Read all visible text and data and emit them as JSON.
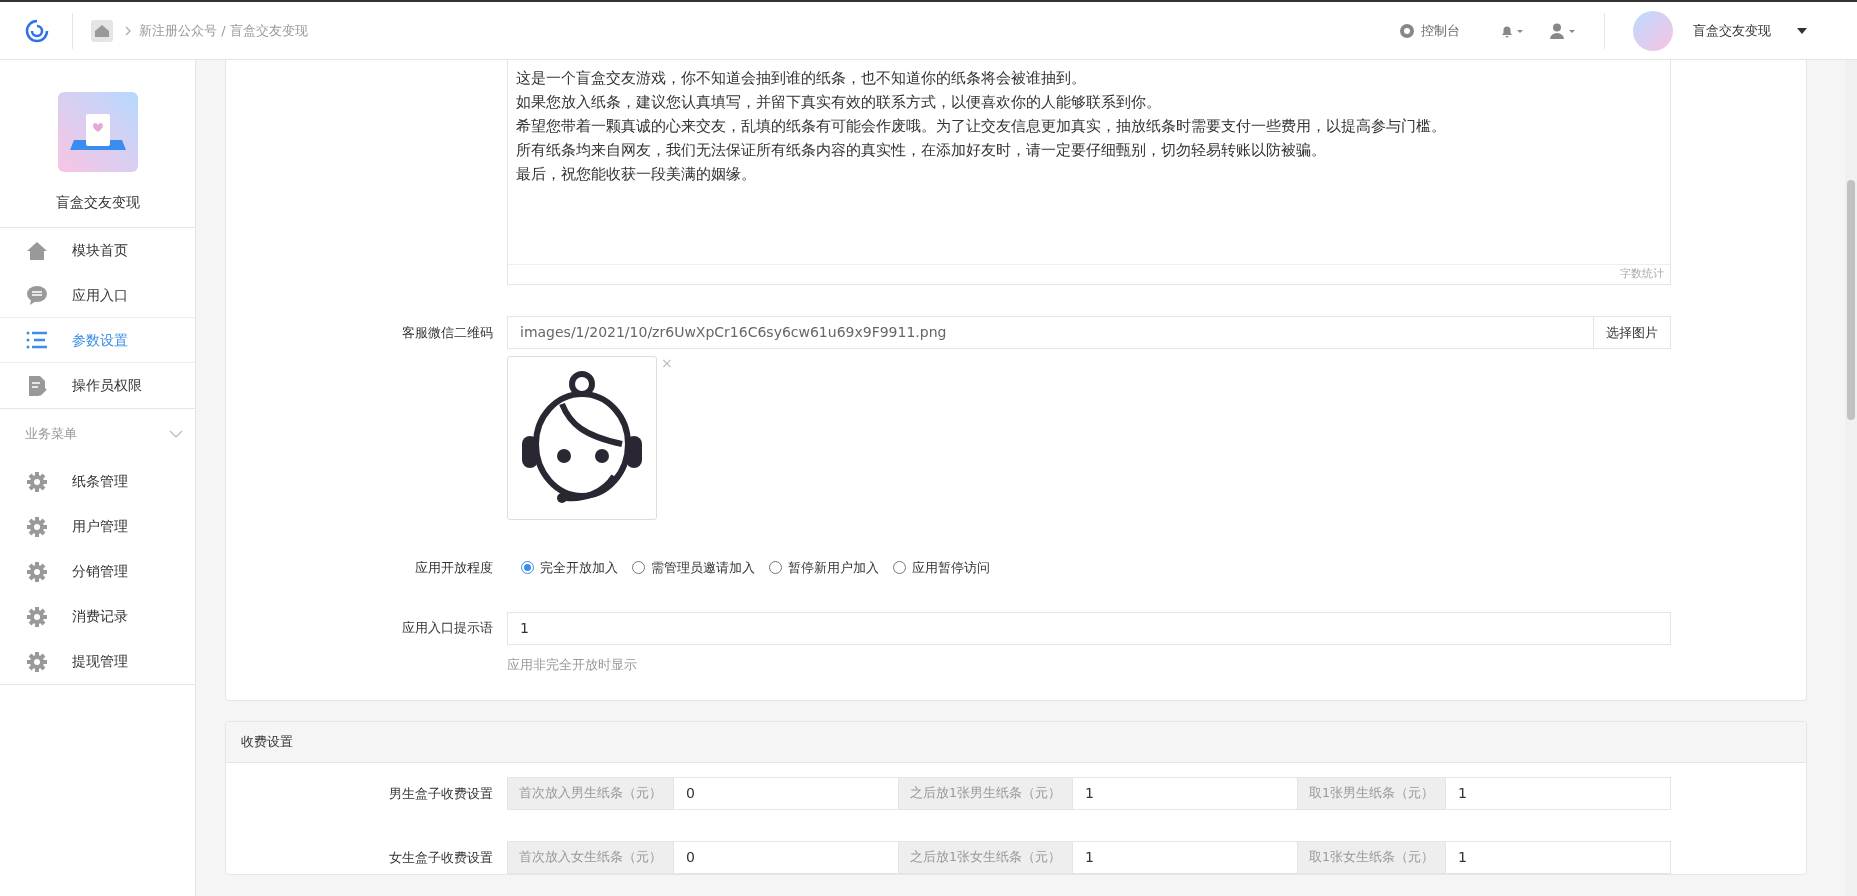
{
  "header": {
    "breadcrumb": "新注册公众号 / 盲盒交友变现",
    "console": "控制台",
    "user_name": "盲盒交友变现"
  },
  "sidebar": {
    "app_name": "盲盒交友变现",
    "items": [
      {
        "label": "模块首页",
        "kind": "home",
        "selected": false
      },
      {
        "label": "应用入口",
        "kind": "chat",
        "selected": false
      },
      {
        "label": "参数设置",
        "kind": "list",
        "selected": true
      },
      {
        "label": "操作员权限",
        "kind": "doc",
        "selected": false
      }
    ],
    "section": {
      "title": "业务菜单",
      "expanded": true,
      "items": [
        {
          "label": "纸条管理",
          "selected": false
        },
        {
          "label": "用户管理",
          "selected": false
        },
        {
          "label": "分销管理",
          "selected": false
        },
        {
          "label": "消费记录",
          "selected": false
        },
        {
          "label": "提现管理",
          "selected": false
        }
      ]
    }
  },
  "intro": {
    "lines": [
      "这是一个盲盒交友游戏，你不知道会抽到谁的纸条，也不知道你的纸条将会被谁抽到。",
      "如果您放入纸条，建议您认真填写，并留下真实有效的联系方式，以便喜欢你的人能够联系到你。",
      "希望您带着一颗真诚的心来交友，乱填的纸条有可能会作废哦。为了让交友信息更加真实，抽放纸条时需要支付一些费用，以提高参与门槛。",
      "所有纸条均来自网友，我们无法保证所有纸条内容的真实性，在添加好友时，请一定要仔细甄别，切勿轻易转账以防被骗。",
      "最后，祝您能收获一段美满的姻缘。"
    ],
    "counter": "字数统计"
  },
  "qr": {
    "label": "客服微信二维码",
    "value": "images/1/2021/10/zr6UwXpCr16C6sy6cw61u69x9F9911.png",
    "button": "选择图片",
    "remove": "×"
  },
  "access": {
    "label": "应用开放程度",
    "options": [
      {
        "label": "完全开放加入",
        "selected": true
      },
      {
        "label": "需管理员邀请加入",
        "selected": false
      },
      {
        "label": "暂停新用户加入",
        "selected": false
      },
      {
        "label": "应用暂停访问",
        "selected": false
      }
    ]
  },
  "hint": {
    "label": "应用入口提示语",
    "value": "1",
    "help": "应用非完全开放时显示"
  },
  "fees": {
    "title": "收费设置",
    "rows": [
      {
        "label": "男生盒子收费设置",
        "fields": [
          {
            "addon": "首次放入男生纸条（元）",
            "value": "0"
          },
          {
            "addon": "之后放1张男生纸条（元）",
            "value": "1"
          },
          {
            "addon": "取1张男生纸条（元）",
            "value": "1"
          }
        ]
      },
      {
        "label": "女生盒子收费设置",
        "fields": [
          {
            "addon": "首次放入女生纸条（元）",
            "value": "0"
          },
          {
            "addon": "之后放1张女生纸条（元）",
            "value": "1"
          },
          {
            "addon": "取1张女生纸条（元）",
            "value": "1"
          }
        ]
      }
    ]
  }
}
